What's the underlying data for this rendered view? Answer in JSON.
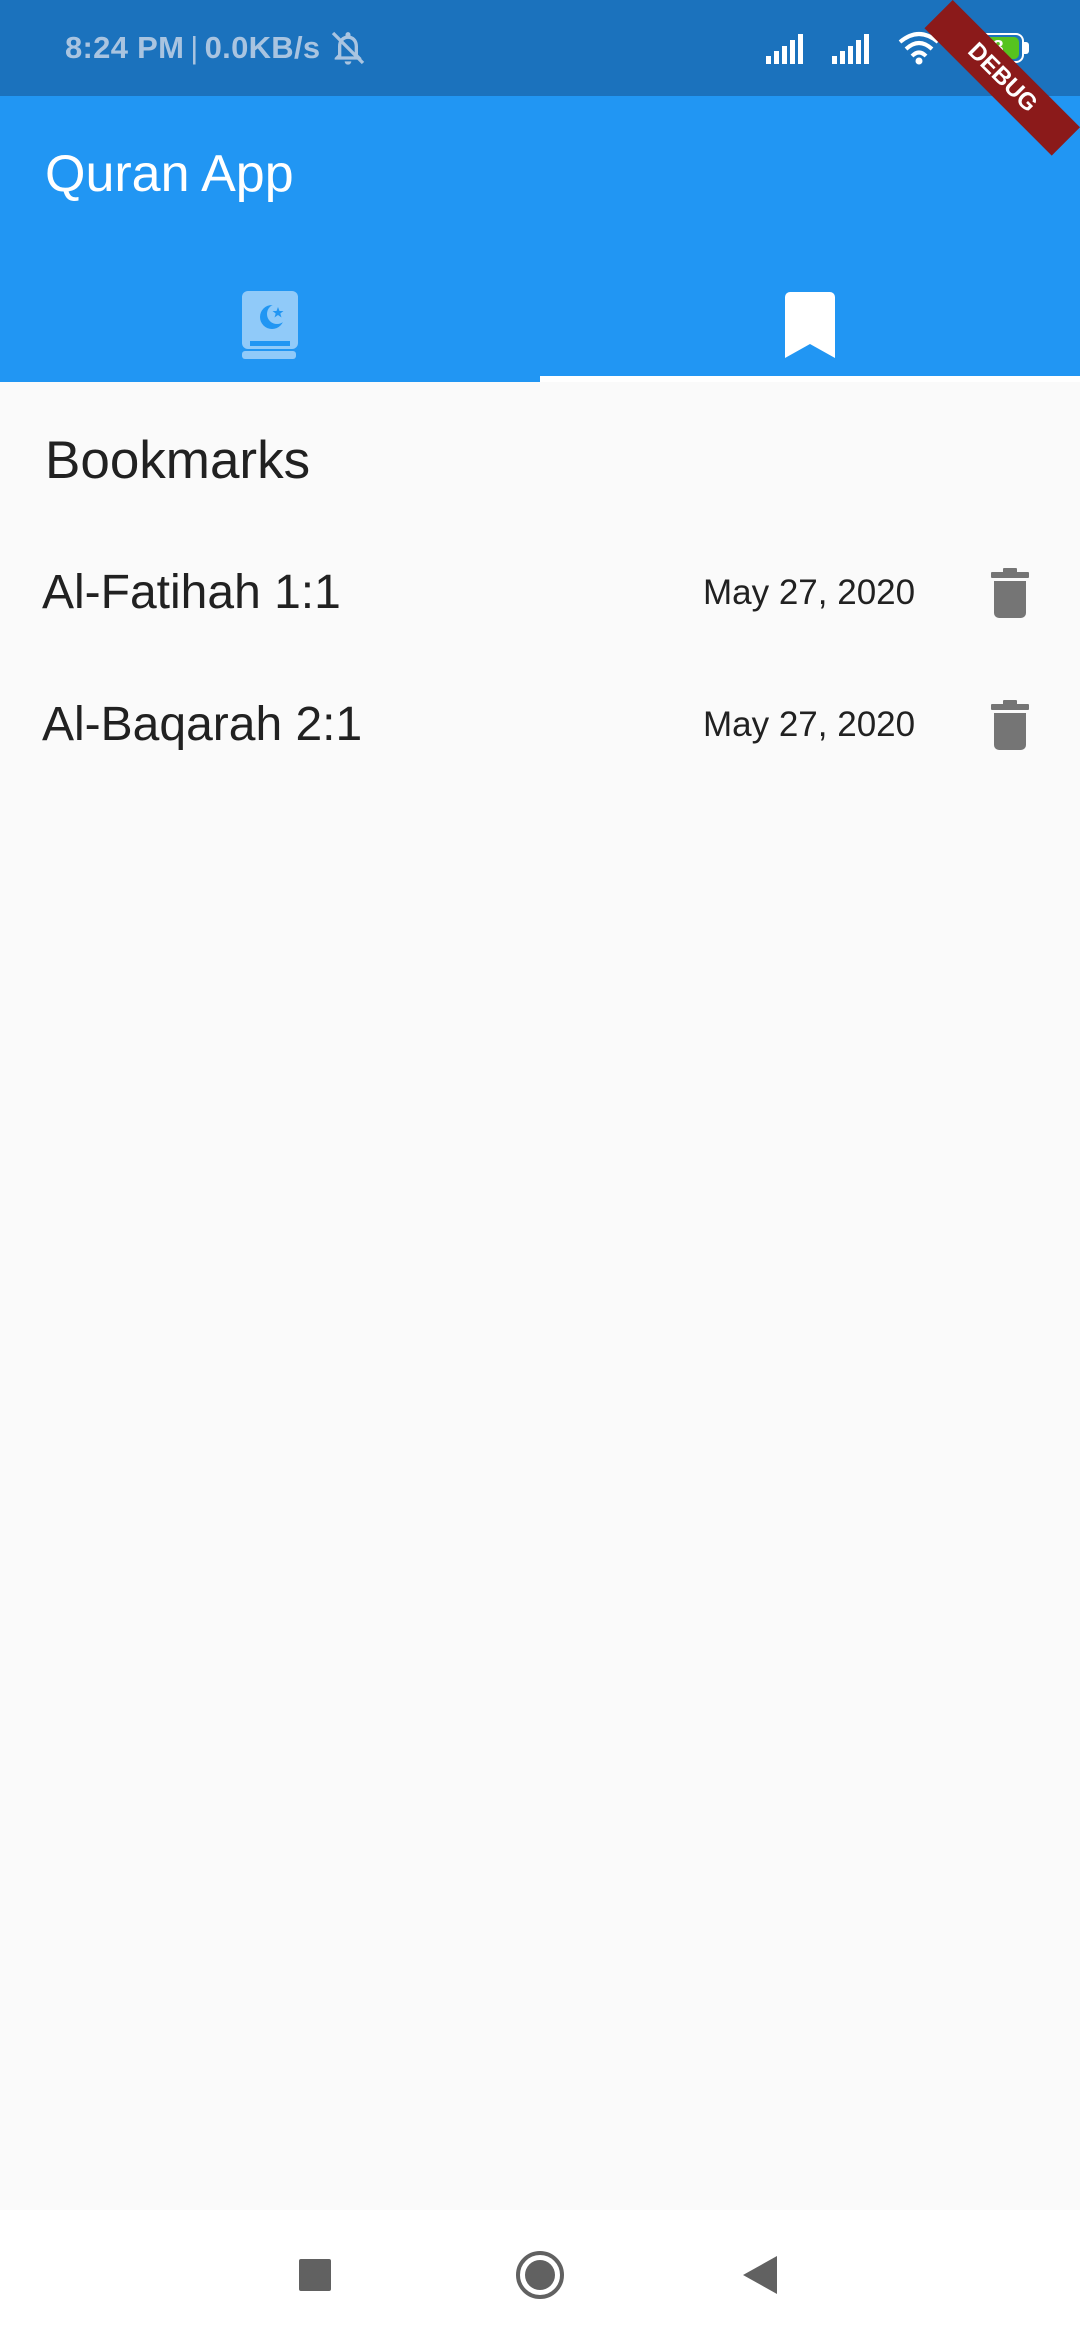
{
  "status_bar": {
    "time": "8:24 PM",
    "separator": "|",
    "network_speed": "0.0KB/s",
    "battery_level": "98",
    "icons": [
      "muted-bell-icon",
      "signal-icon",
      "signal-icon",
      "wifi-icon",
      "battery-icon"
    ]
  },
  "app_bar": {
    "title": "Quran App"
  },
  "tabs": [
    {
      "icon": "quran-book-icon",
      "selected": false
    },
    {
      "icon": "bookmark-icon",
      "selected": true
    }
  ],
  "bookmarks": {
    "heading": "Bookmarks",
    "items": [
      {
        "title": "Al-Fatihah 1:1",
        "date": "May 27, 2020",
        "action_icon": "trash-icon"
      },
      {
        "title": "Al-Baqarah 2:1",
        "date": "May 27, 2020",
        "action_icon": "trash-icon"
      }
    ]
  },
  "debug_banner": {
    "label": "DEBUG"
  },
  "nav_bar": {
    "icons": [
      "recents-square-icon",
      "home-circle-icon",
      "back-triangle-icon"
    ]
  },
  "colors": {
    "status_bar": "#1b72bd",
    "app_bar": "#2196f3",
    "background": "#fafafa",
    "debug_banner": "#8b1a1a",
    "battery_fill": "#56c31f"
  }
}
